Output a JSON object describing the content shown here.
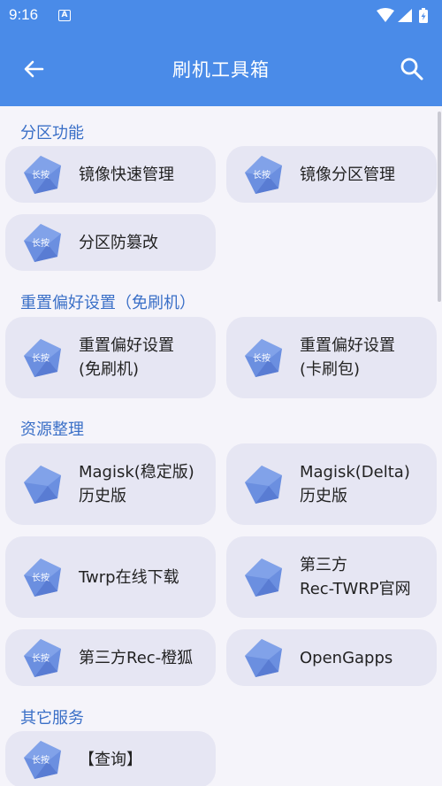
{
  "status": {
    "time": "9:16",
    "notif": "A"
  },
  "appbar": {
    "title": "刷机工具箱"
  },
  "icons": {
    "back": "arrow-back-icon",
    "search": "search-icon",
    "tool": "pentagon-tool-icon"
  },
  "colors": {
    "primary": "#4a8be8",
    "section": "#3a6fc7",
    "card": "#e6e6f3",
    "icon": "#6b8fe0"
  },
  "sections": [
    {
      "title": "分区功能"
    },
    {
      "title": "重置偏好设置（免刷机）"
    },
    {
      "title": "资源整理"
    },
    {
      "title": "其它服务"
    }
  ],
  "cards": [
    {
      "line1": "镜像快速管理",
      "line2": "",
      "badge": "长按"
    },
    {
      "line1": "镜像分区管理",
      "line2": "",
      "badge": "长按"
    },
    {
      "line1": "分区防篡改",
      "line2": "",
      "badge": "长按"
    },
    {
      "line1": "重置偏好设置",
      "line2": "(免刷机)",
      "badge": "长按"
    },
    {
      "line1": "重置偏好设置",
      "line2": "(卡刷包)",
      "badge": "长按"
    },
    {
      "line1": "Magisk(稳定版)",
      "line2": "历史版",
      "badge": ""
    },
    {
      "line1": "Magisk(Delta)",
      "line2": "历史版",
      "badge": ""
    },
    {
      "line1": "Twrp在线下载",
      "line2": "",
      "badge": "长按"
    },
    {
      "line1": "第三方",
      "line2": "Rec-TWRP官网",
      "badge": ""
    },
    {
      "line1": "第三方Rec-橙狐",
      "line2": "",
      "badge": "长按"
    },
    {
      "line1": "OpenGapps",
      "line2": "",
      "badge": ""
    },
    {
      "line1": "【查询】",
      "line2": "",
      "badge": "长按"
    }
  ]
}
